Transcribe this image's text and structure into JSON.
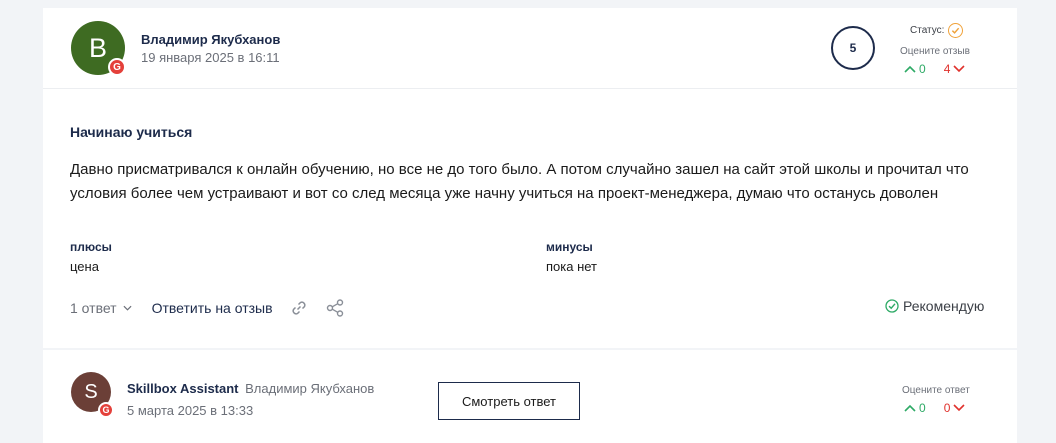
{
  "review": {
    "avatar_letter": "B",
    "source_badge": "G",
    "author": "Владимир Якубханов",
    "date": "19 января 2025 в 16:11",
    "rating": "5",
    "status_label": "Статус:",
    "rate_label": "Оцените отзыв",
    "votes_up": "0",
    "votes_down": "4",
    "title": "Начинаю учиться",
    "text": "Давно присматривался к онлайн обучению, но все не до того было. А потом случайно зашел на сайт этой школы и прочитал что условия более чем устраивают и вот со след месяца уже начну учиться на проект-менеджера, думаю что останусь доволен",
    "pros_label": "плюсы",
    "pros": "цена",
    "cons_label": "минусы",
    "cons": "пока нет",
    "answers_count": "1 ответ",
    "reply_link": "Ответить на отзыв",
    "recommend_label": "Рекомендую"
  },
  "reply": {
    "avatar_letter": "S",
    "source_badge": "G",
    "author": "Skillbox Assistant",
    "reply_to": "Владимир Якубханов",
    "date": "5 марта 2025 в 13:33",
    "view_button": "Смотреть ответ",
    "rate_label": "Оцените ответ",
    "votes_up": "0",
    "votes_down": "0"
  },
  "colors": {
    "accent_navy": "#1d2b4b",
    "vote_up": "#2eaa66",
    "vote_down": "#e0322d",
    "status_orange": "#f0a23a",
    "recommend_green": "#2eaa66"
  }
}
